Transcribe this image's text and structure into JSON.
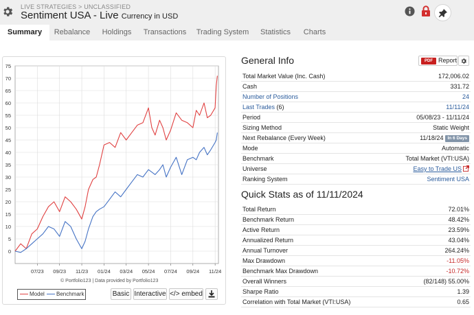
{
  "header": {
    "breadcrumb": "LIVE STRATEGIES > UNCLASSIFIED",
    "title": "Sentiment USA - Live",
    "currency": "Currency in USD",
    "icons": [
      "gear-icon",
      "info-icon",
      "lock-icon",
      "pin-icon"
    ]
  },
  "tabs": [
    {
      "label": "Summary",
      "active": true
    },
    {
      "label": "Rebalance",
      "active": false
    },
    {
      "label": "Holdings",
      "active": false
    },
    {
      "label": "Transactions",
      "active": false
    },
    {
      "label": "Trading System",
      "active": false
    },
    {
      "label": "Statistics",
      "active": false
    },
    {
      "label": "Charts",
      "active": false
    }
  ],
  "chart": {
    "credit": "© Portfolio123 | Data provided by Portfolio123",
    "legend": [
      "Model",
      "Benchmark"
    ],
    "buttons": {
      "basic": "Basic",
      "interactive": "Interactive",
      "embed": "</> embed"
    }
  },
  "chart_data": {
    "type": "line",
    "title": "",
    "xlabel": "",
    "ylabel": "",
    "ylim": [
      -5,
      75
    ],
    "yticks": [
      0,
      5,
      10,
      15,
      20,
      25,
      30,
      35,
      40,
      45,
      50,
      55,
      60,
      65,
      70,
      75
    ],
    "x_tick_labels": [
      "07/23",
      "09/23",
      "11/23",
      "01/24",
      "03/24",
      "05/24",
      "07/24",
      "09/24",
      "11/24"
    ],
    "x_ticks_month_offset": [
      2,
      4,
      6,
      8,
      10,
      12,
      14,
      16,
      18
    ],
    "x_months_from_start": [
      0,
      0.5,
      1,
      1.5,
      2,
      2.5,
      3,
      3.5,
      4,
      4.5,
      5,
      5.5,
      6,
      6.3,
      6.6,
      7,
      7.3,
      7.6,
      8,
      8.5,
      9,
      9.5,
      10,
      10.5,
      11,
      11.5,
      12,
      12.3,
      12.6,
      13,
      13.3,
      13.6,
      14,
      14.5,
      15,
      15.5,
      16,
      16.3,
      16.6,
      17,
      17.3,
      17.6,
      18,
      18.1,
      18.2
    ],
    "grid": true,
    "legend_position": "bottom-left",
    "series": [
      {
        "name": "Model",
        "color": "#e04040",
        "values": [
          0,
          3,
          1,
          7,
          9,
          14,
          18,
          20,
          16,
          22,
          20,
          17,
          13,
          18,
          25,
          29,
          30,
          35,
          43,
          44,
          42,
          48,
          45,
          48,
          51,
          52,
          58,
          50,
          47,
          53,
          50,
          45,
          49,
          56,
          53,
          52,
          50,
          57,
          55,
          60,
          54,
          55,
          58,
          67,
          71
        ]
      },
      {
        "name": "Benchmark",
        "color": "#4472c4",
        "values": [
          0,
          -0.5,
          1,
          3,
          5,
          7,
          10,
          9,
          6,
          12,
          10,
          5,
          1,
          4,
          9,
          14,
          16,
          17,
          18,
          21,
          24,
          22,
          25,
          28,
          31,
          30,
          33,
          32,
          31,
          33,
          35,
          30,
          34,
          38,
          31,
          37,
          38,
          37,
          40,
          42,
          39,
          41,
          44,
          45,
          48
        ]
      }
    ]
  },
  "general_info": {
    "title": "General Info",
    "report_badge": "PDF",
    "report_label": "Report",
    "rows": [
      {
        "label": "Total Market Value (Inc. Cash)",
        "value": "172,006.02"
      },
      {
        "label": "Cash",
        "value": "331.72"
      },
      {
        "label": "Number of Positions",
        "value": "24"
      },
      {
        "label": "Last Trades",
        "label_count": "(6)",
        "value": "11/11/24"
      },
      {
        "label": "Period",
        "value": "05/08/23 - 11/11/24"
      },
      {
        "label": "Sizing Method",
        "value": "Static Weight"
      },
      {
        "label": "Next Rebalance (Every Week)",
        "value": "11/18/24",
        "badge": "In 6 Days"
      },
      {
        "label": "Mode",
        "value": "Automatic"
      },
      {
        "label": "Benchmark",
        "value": "Total Market (VTI:USA)"
      },
      {
        "label": "Universe",
        "value": "Easy to Trade US"
      },
      {
        "label": "Ranking System",
        "value": "Sentiment USA"
      }
    ]
  },
  "quick_stats": {
    "title": "Quick Stats as of 11/11/2024",
    "rows": [
      {
        "label": "Total Return",
        "value": "72.01%"
      },
      {
        "label": "Benchmark Return",
        "value": "48.42%"
      },
      {
        "label": "Active Return",
        "value": "23.59%"
      },
      {
        "label": "Annualized Return",
        "value": "43.04%"
      },
      {
        "label": "Annual Turnover",
        "value": "264.24%"
      },
      {
        "label": "Max Drawdown",
        "value": "-11.05%"
      },
      {
        "label": "Benchmark Max Drawdown",
        "value": "-10.72%"
      },
      {
        "label": "Overall Winners",
        "value": "(82/148) 55.00%"
      },
      {
        "label": "Sharpe Ratio",
        "value": "1.39"
      },
      {
        "label": "Correlation with Total Market (VTI:USA)",
        "value": "0.65"
      }
    ]
  }
}
